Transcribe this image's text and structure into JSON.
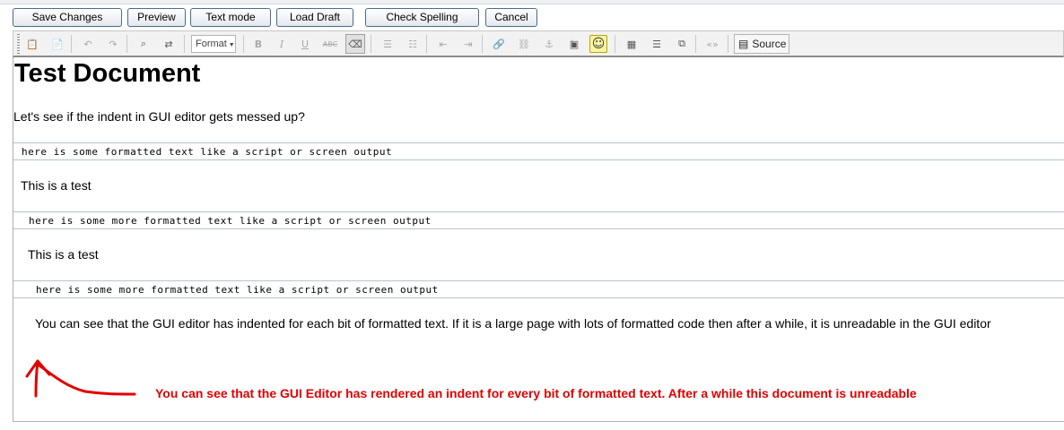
{
  "buttons": {
    "save": "Save Changes",
    "preview": "Preview",
    "text_mode": "Text mode",
    "load_draft": "Load Draft",
    "check_spelling": "Check Spelling",
    "cancel": "Cancel"
  },
  "toolbar": {
    "format_label": "Format",
    "source_label": "Source",
    "bold": "B",
    "italic": "I",
    "underline": "U",
    "strike": "ABC"
  },
  "document": {
    "title": "Test Document",
    "intro": "Let's see if the indent in GUI editor gets messed up?",
    "blocks": [
      {
        "pre": "here is some formatted text like a script or screen output",
        "text": "This is a test"
      },
      {
        "pre": "here is some more formatted text like a script or screen output",
        "text": "This is a test"
      },
      {
        "pre": "here is some more formatted text like a script or screen output",
        "text": "You can see that the GUI editor has indented for each bit of formatted text. If it is a large page with lots of formatted code then after a while, it is unreadable in the GUI editor"
      }
    ]
  },
  "annotation": {
    "text": "You can see that the GUI Editor has rendered an indent for every bit of formatted text. After a while this document is unreadable",
    "color": "#e00000"
  },
  "colors": {
    "button_border": "#4a6b8f",
    "toolbar_bg": "#f2f2f2",
    "pre_border": "#b7c3d1"
  }
}
